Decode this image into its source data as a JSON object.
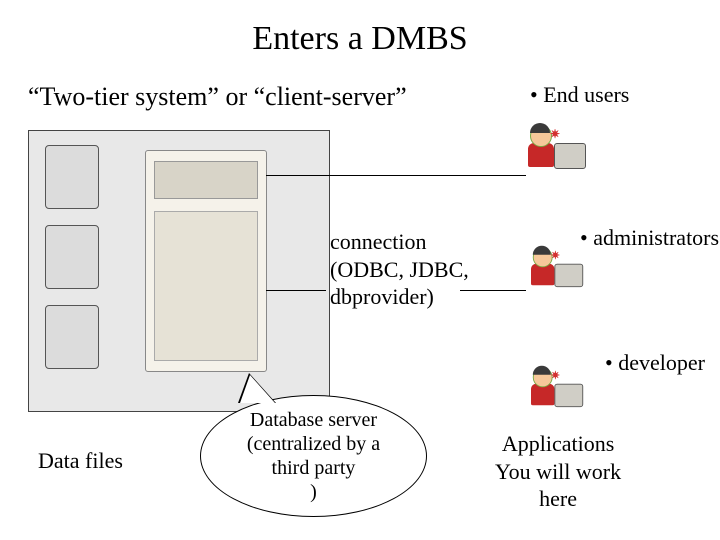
{
  "title": "Enters a DMBS",
  "subtitle": "“Two-tier system” or “client-server”",
  "labels": {
    "end_users": "• End users",
    "administrators": "• administrators",
    "developer": "• developer",
    "data_files": "Data files"
  },
  "connection": {
    "line1": "connection",
    "line2": "(ODBC, JDBC,",
    "line3": "dbprovider)"
  },
  "bubble": {
    "line1": "Database server",
    "line2": "(centralized by a",
    "line3": "third party",
    "line4": ")"
  },
  "apps": {
    "line1": "Applications",
    "line2": "You will work",
    "line3": "here"
  }
}
